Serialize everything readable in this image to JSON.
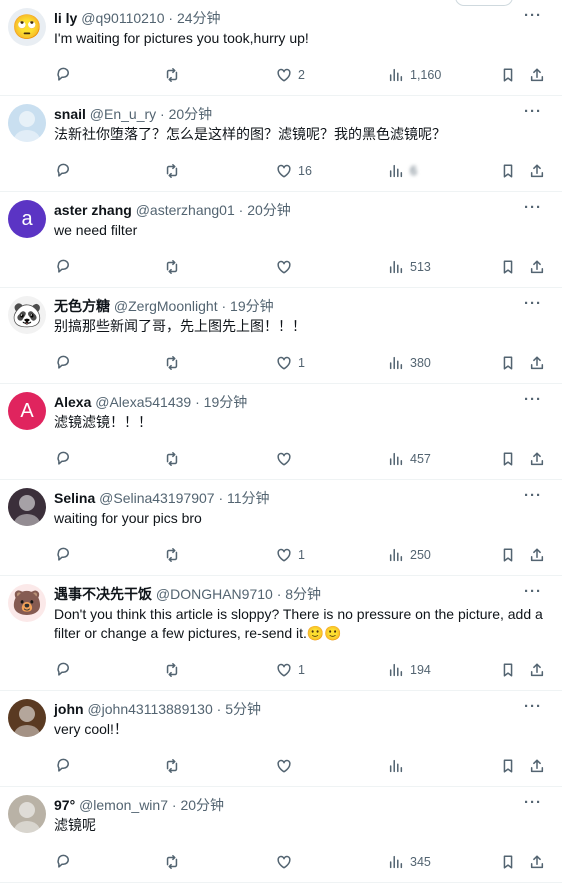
{
  "tweets": [
    {
      "name": "li ly",
      "handle": "@q90110210",
      "time": "24分钟",
      "text": "I'm waiting for pictures you took,hurry up!",
      "likes": "2",
      "views": "1,160",
      "avatar": {
        "kind": "emoji",
        "glyph": "🙄",
        "bg": "#e9eef3"
      }
    },
    {
      "name": "snail",
      "handle": "@En_u_ry",
      "time": "20分钟",
      "text": "法新社你堕落了？怎么是这样的图？滤镜呢？我的黑色滤镜呢？",
      "likes": "16",
      "views": "6",
      "avatar": {
        "kind": "pic",
        "bg": "#c9dff0"
      }
    },
    {
      "name": "aster zhang",
      "handle": "@asterzhang01",
      "time": "20分钟",
      "text": "we need filter",
      "likes": "",
      "views": "513",
      "avatar": {
        "kind": "letter",
        "glyph": "a",
        "bg": "#5b34c4"
      }
    },
    {
      "name": "无色方糖",
      "handle": "@ZergMoonlight",
      "time": "19分钟",
      "text": "别搞那些新闻了哥，先上图先上图！！！",
      "likes": "1",
      "views": "380",
      "avatar": {
        "kind": "emoji",
        "glyph": "🐼",
        "bg": "#f2f2f2"
      }
    },
    {
      "name": "Alexa",
      "handle": "@Alexa541439",
      "time": "19分钟",
      "text": "滤镜滤镜！！！",
      "likes": "",
      "views": "457",
      "avatar": {
        "kind": "letter",
        "glyph": "A",
        "bg": "#e0245e"
      }
    },
    {
      "name": "Selina",
      "handle": "@Selina43197907",
      "time": "11分钟",
      "text": "waiting for your pics bro",
      "likes": "1",
      "views": "250",
      "avatar": {
        "kind": "pic",
        "bg": "#3b2f3a"
      }
    },
    {
      "name": "遇事不决先干饭",
      "handle": "@DONGHAN9710",
      "time": "8分钟",
      "text": "Don't you think this article is sloppy? There is no pressure on the picture, add a filter or change a few pictures, re-send it.🙂🙂",
      "likes": "1",
      "views": "194",
      "avatar": {
        "kind": "emoji",
        "glyph": "🐻",
        "bg": "#fbe9e9"
      }
    },
    {
      "name": "john",
      "handle": "@john43113889130",
      "time": "5分钟",
      "text": "very cool!！",
      "likes": "",
      "views": "",
      "avatar": {
        "kind": "pic",
        "bg": "#5a3a22"
      }
    },
    {
      "name": "97°",
      "handle": "@lemon_win7",
      "time": "20分钟",
      "text": "滤镜呢",
      "likes": "",
      "views": "345",
      "avatar": {
        "kind": "pic",
        "bg": "#b9b2a6"
      }
    }
  ],
  "sep": " · ",
  "more_label": "···",
  "icons": [
    "reply-icon",
    "retweet-icon",
    "like-icon",
    "views-icon",
    "bookmark-icon",
    "share-icon",
    "more-icon"
  ]
}
